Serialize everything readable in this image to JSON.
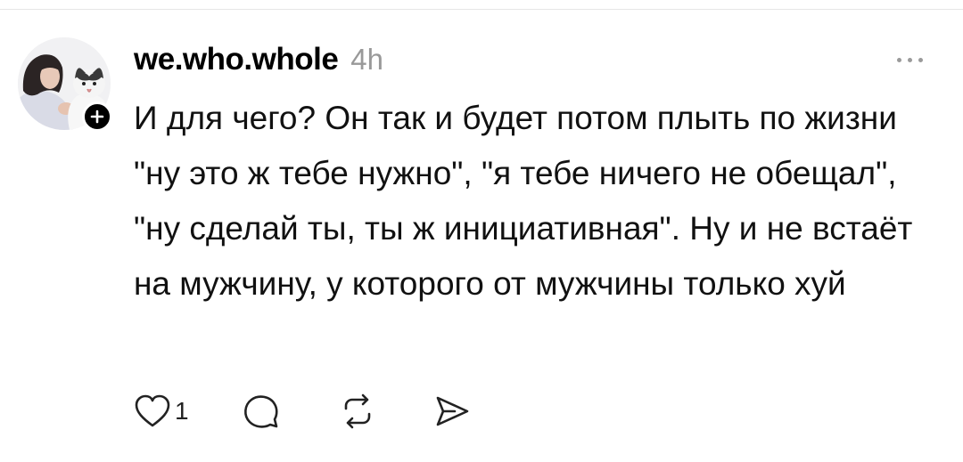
{
  "post": {
    "username": "we.who.whole",
    "timestamp": "4h",
    "text": "И для чего? Он так и будет потом плыть по жизни \"ну это ж тебе нужно\", \"я тебе ничего не обещал\", \"ну сделай ты, ты ж инициативная\". Ну и не встаёт на мужчину, у которого от мужчины только хуй",
    "like_count": "1"
  },
  "icons": {
    "follow": "plus-icon",
    "more": "more-horizontal-icon",
    "like": "heart-icon",
    "comment": "comment-icon",
    "repost": "repost-icon",
    "share": "send-icon"
  },
  "colors": {
    "text": "#111111",
    "muted": "#999999",
    "badge": "#000000"
  }
}
